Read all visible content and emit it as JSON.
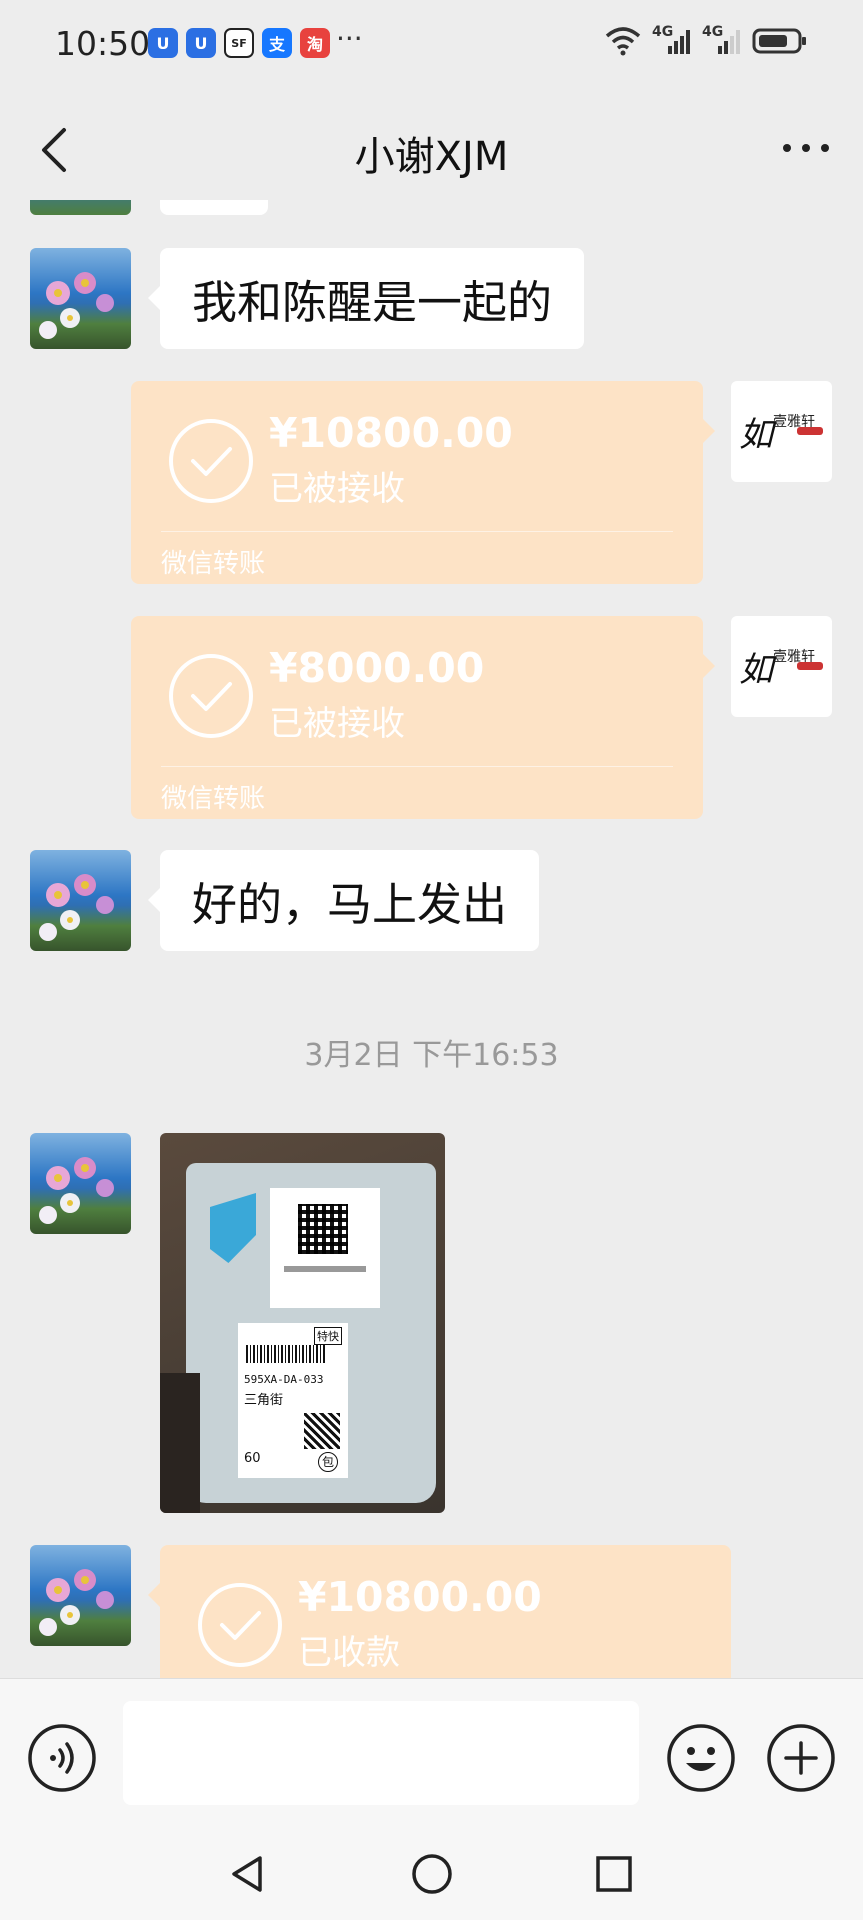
{
  "status_bar": {
    "time": "10:50",
    "more": "···",
    "network_1": "4G",
    "network_2": "4G"
  },
  "header": {
    "title": "小谢XJM"
  },
  "messages": {
    "msg1_text": "我和陈醒是一起的",
    "transfer1": {
      "amount": "¥10800.00",
      "status": "已被接收",
      "footer": "微信转账"
    },
    "transfer2": {
      "amount": "¥8000.00",
      "status": "已被接收",
      "footer": "微信转账"
    },
    "msg2_text": "好的，马上发出",
    "timestamp": "3月2日 下午16:53",
    "photo": {
      "label_code": "595XA-DA-033",
      "label_area": "三角街",
      "label_badge": "特快",
      "label_num": "60",
      "stamp": "包"
    },
    "transfer3": {
      "amount": "¥10800.00",
      "status": "已收款"
    }
  },
  "brand_avatar": {
    "script": "如",
    "name": "壹雅轩"
  },
  "input_bar": {
    "placeholder": ""
  },
  "colors": {
    "transfer_bg": "#fde3c6",
    "chat_bg": "#ededed",
    "bubble": "#ffffff"
  }
}
